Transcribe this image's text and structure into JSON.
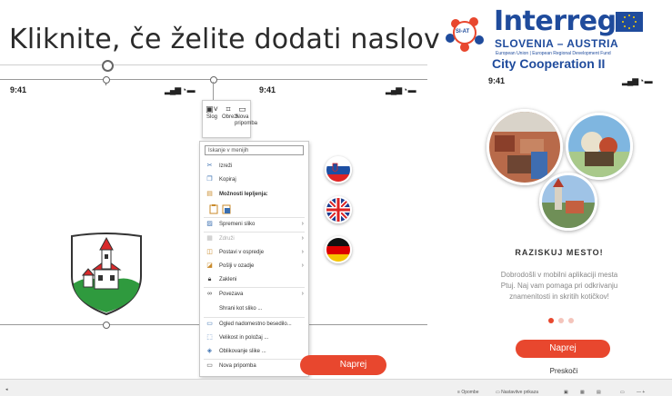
{
  "slide": {
    "title": "Kliknite, če želite dodati naslov"
  },
  "phones": {
    "left_time": "9:41",
    "middle_time": "9:41",
    "right_time": "9:41"
  },
  "logo": {
    "word": "Interreg",
    "country": "SLOVENIA – AUSTRIA",
    "fund": "European Union | European Regional Development Fund",
    "city": "City Cooperation II",
    "badge": "SI-AT"
  },
  "mini_toolbar": {
    "style_label": "Slog",
    "crop_label": "Obreži",
    "comment_label_1": "Nova",
    "comment_label_2": "pripomba"
  },
  "context_menu": {
    "search_placeholder": "Iskanje v menijih",
    "items": [
      {
        "label": "Izreži"
      },
      {
        "label": "Kopiraj"
      },
      {
        "label": "Možnosti lepljenja:"
      },
      {
        "label": "Spremeni sliko"
      },
      {
        "label": "Združi"
      },
      {
        "label": "Postavi v ospredje"
      },
      {
        "label": "Pošlji v ozadje"
      },
      {
        "label": "Zakleni"
      },
      {
        "label": "Povezava"
      },
      {
        "label": "Shrani kot sliko ..."
      },
      {
        "label": "Ogled nadomestno besedilo..."
      },
      {
        "label": "Velikost in položaj ..."
      },
      {
        "label": "Oblikovanje slike ..."
      },
      {
        "label": "Nova pripomba"
      }
    ]
  },
  "middle_screen": {
    "button_label": "Naprej"
  },
  "right_screen": {
    "heading": "RAZISKUJ MESTO!",
    "desc_line1": "Dobrodošli v mobilni aplikaciji mesta",
    "desc_line2": "Ptuj. Naj vam pomaga pri odkrivanju",
    "desc_line3": "znamenitosti in skritih kotičkov!",
    "button_label": "Naprej",
    "skip_label": "Preskoči",
    "active_dot": 1,
    "dot_count": 3
  },
  "status_bar": {
    "notes_label": "Opombe",
    "display_label": "Nastavitve prikaza"
  },
  "colors": {
    "accent_red": "#e8472e",
    "interreg_blue": "#1f4b9c",
    "shield_green": "#2f9a3e",
    "shield_red": "#d9292b"
  }
}
